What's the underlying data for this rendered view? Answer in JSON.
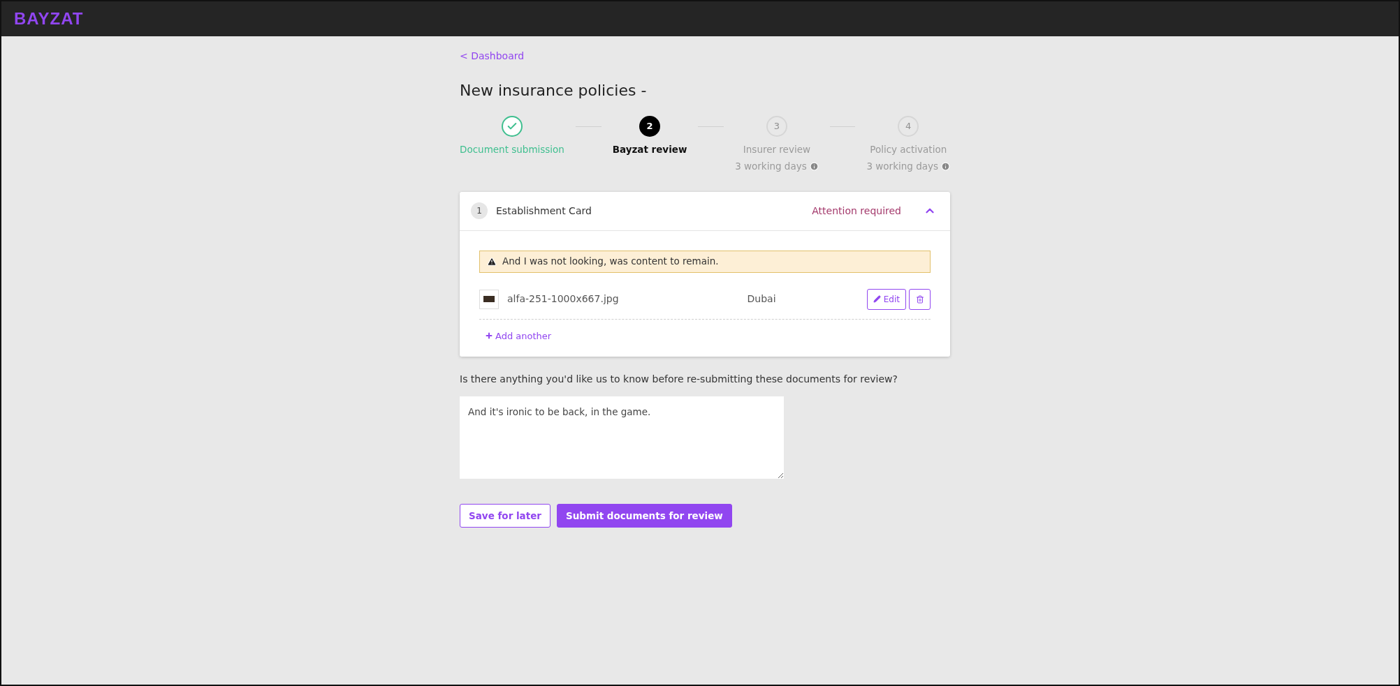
{
  "header": {
    "logo": "BAYZAT"
  },
  "back_link": "< Dashboard",
  "title": "New insurance policies -",
  "steps": [
    {
      "label": "Document submission",
      "completed": true,
      "selected": false
    },
    {
      "number": "2",
      "label": "Bayzat review",
      "completed": false,
      "selected": true
    },
    {
      "number": "3",
      "label": "Insurer review",
      "sublabel": "3 working days",
      "completed": false,
      "selected": false
    },
    {
      "number": "4",
      "label": "Policy activation",
      "sublabel": "3 working days",
      "completed": false,
      "selected": false
    }
  ],
  "section": {
    "number": "1",
    "title": "Establishment Card",
    "status": "Attention required",
    "expanded": true,
    "alert": "And I was not looking, was content to remain.",
    "files": [
      {
        "name": "alfa-251-1000x667.jpg",
        "location": "Dubai",
        "edit": "Edit"
      }
    ],
    "add_link": "Add another"
  },
  "question": "Is there anything you'd like us to know before re-submitting these documents for review?",
  "comment": "And it's ironic to be back, in the game.",
  "buttons": [
    {
      "label": "Save for later",
      "kind": "secondary"
    },
    {
      "label": "Submit documents for review",
      "kind": "primary"
    }
  ]
}
